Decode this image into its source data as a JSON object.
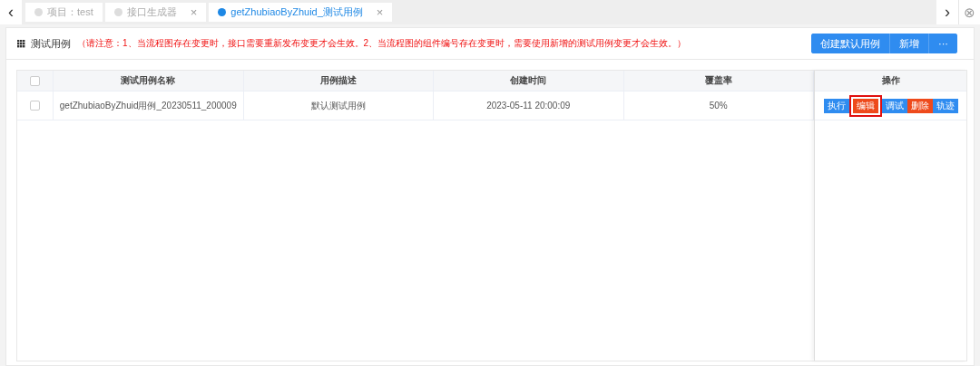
{
  "tabs": [
    {
      "label": "项目：test",
      "selected": false
    },
    {
      "label": "接口生成器",
      "selected": false,
      "close": "×"
    },
    {
      "label": "getZhubiaoByZhuid_测试用例",
      "selected": true,
      "close": "×"
    }
  ],
  "nav": {
    "prev": "‹",
    "next": "›",
    "close_all": "⊗"
  },
  "panel": {
    "title": "测试用例",
    "notice": "（请注意：1、当流程图存在变更时，接口需要重新发布变更才会生效。2、当流程图的组件编号存在变更时，需要使用新增的测试用例变更才会生效。）",
    "buttons": [
      {
        "label": "创建默认用例"
      },
      {
        "label": "新增"
      },
      {
        "label": "···"
      }
    ]
  },
  "table": {
    "select_all": {
      "checked": false
    },
    "columns": [
      "测试用例名称",
      "用例描述",
      "创建时间",
      "覆盖率",
      "操作"
    ],
    "rows": [
      {
        "checked": false,
        "cells": [
          "getZhubiaoByZhuid用例_20230511_200009",
          "默认测试用例",
          "2023-05-11 20:00:09",
          "50%"
        ],
        "actions": [
          {
            "label": "执行",
            "kind": "primary",
            "highlighted": false
          },
          {
            "label": "编辑",
            "kind": "danger",
            "highlighted": true
          },
          {
            "label": "调试",
            "kind": "primary",
            "highlighted": false
          },
          {
            "label": "删除",
            "kind": "danger",
            "highlighted": false
          },
          {
            "label": "轨迹",
            "kind": "primary",
            "highlighted": false
          }
        ]
      }
    ]
  }
}
